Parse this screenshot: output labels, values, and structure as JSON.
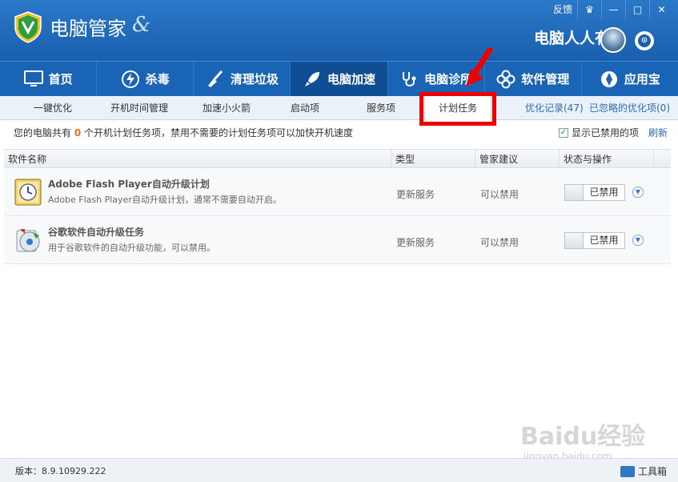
{
  "app": {
    "title": "电脑管家",
    "swoosh": "&"
  },
  "window_controls": {
    "feedback": "反馈",
    "skin": "♛",
    "minimize": "—",
    "maximize": "□",
    "close": "✕"
  },
  "user": {
    "name": "电脑人人有"
  },
  "main_nav": [
    {
      "label": "首页",
      "icon": "monitor-icon"
    },
    {
      "label": "杀毒",
      "icon": "bolt-icon"
    },
    {
      "label": "清理垃圾",
      "icon": "broom-icon"
    },
    {
      "label": "电脑加速",
      "icon": "rocket-icon",
      "active": true
    },
    {
      "label": "电脑诊所",
      "icon": "stethoscope-icon"
    },
    {
      "label": "软件管理",
      "icon": "clover-icon"
    },
    {
      "label": "应用宝",
      "icon": "app-store-icon"
    }
  ],
  "sub_tabs": [
    {
      "label": "一键优化"
    },
    {
      "label": "开机时间管理"
    },
    {
      "label": "加速小火箭"
    },
    {
      "label": "启动项"
    },
    {
      "label": "服务项"
    },
    {
      "label": "计划任务",
      "active": true
    }
  ],
  "sub_links": {
    "history": "优化记录(47)",
    "ignored": "已忽略的优化项(0)"
  },
  "info": {
    "prefix": "您的电脑共有 ",
    "count": "0",
    "suffix": " 个开机计划任务项，禁用不需要的计划任务项可以加快开机速度"
  },
  "show_disabled": {
    "label": "显示已禁用的项",
    "checked": true
  },
  "refresh": "刷新",
  "table": {
    "headers": [
      "软件名称",
      "类型",
      "管家建议",
      "状态与操作"
    ],
    "rows": [
      {
        "title": "Adobe Flash Player自动升级计划",
        "desc": "Adobe Flash Player自动升级计划，通常不需要自动开启。",
        "type": "更新服务",
        "advice": "可以禁用",
        "status": "已禁用",
        "icon": "flash-player-icon"
      },
      {
        "title": "谷歌软件自动升级任务",
        "desc": "用于谷歌软件的自动升级功能，可以禁用。",
        "type": "更新服务",
        "advice": "可以禁用",
        "status": "已禁用",
        "icon": "google-update-icon"
      }
    ]
  },
  "footer": {
    "version": "版本：8.9.10929.222",
    "toolbox": "工具箱"
  },
  "watermark": {
    "main": "Baidu经验",
    "sub": "jingyan.baidu.com"
  },
  "colors": {
    "titlebar": "#1f6ab9",
    "nav": "#1a64b5",
    "nav_active": "#0f4e93",
    "highlight": "#e00000",
    "count": "#e96f1b",
    "link": "#2a6db8"
  }
}
